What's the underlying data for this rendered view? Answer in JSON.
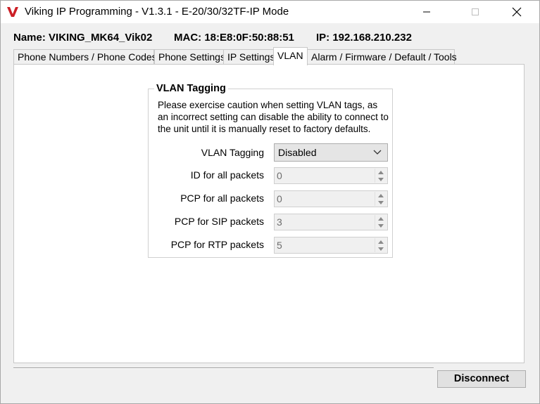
{
  "window": {
    "title": "Viking IP Programming - V1.3.1 - E-20/30/32TF-IP Mode",
    "logo_letter": "V",
    "brand_color": "#cc1f26"
  },
  "info": {
    "name_text": "Name: VIKING_MK64_Vik02",
    "mac_text": "MAC: 18:E8:0F:50:88:51",
    "ip_text": "IP: 192.168.210.232"
  },
  "tabs": [
    {
      "label": "Phone Numbers / Phone Codes",
      "active": false
    },
    {
      "label": "Phone Settings",
      "active": false
    },
    {
      "label": "IP Settings",
      "active": false
    },
    {
      "label": "VLAN",
      "active": true
    },
    {
      "label": "Alarm / Firmware / Default / Tools",
      "active": false
    }
  ],
  "vlan": {
    "group_title": "VLAN Tagging",
    "caution": "Please exercise caution when setting VLAN tags, as an incorrect setting can disable the ability to connect to the unit until it is manually reset to factory defaults.",
    "tagging_label": "VLAN Tagging",
    "tagging_value": "Disabled",
    "fields": [
      {
        "label": "ID for all packets",
        "value": "0"
      },
      {
        "label": "PCP for all packets",
        "value": "0"
      },
      {
        "label": "PCP for SIP packets",
        "value": "3"
      },
      {
        "label": "PCP for RTP packets",
        "value": "5"
      }
    ]
  },
  "footer": {
    "disconnect_label": "Disconnect"
  },
  "icons": {
    "minimize": "minimize-icon",
    "maximize": "maximize-icon",
    "close": "close-icon",
    "dropdown": "chevron-down-icon",
    "spin_up": "spin-up-icon",
    "spin_down": "spin-down-icon"
  }
}
